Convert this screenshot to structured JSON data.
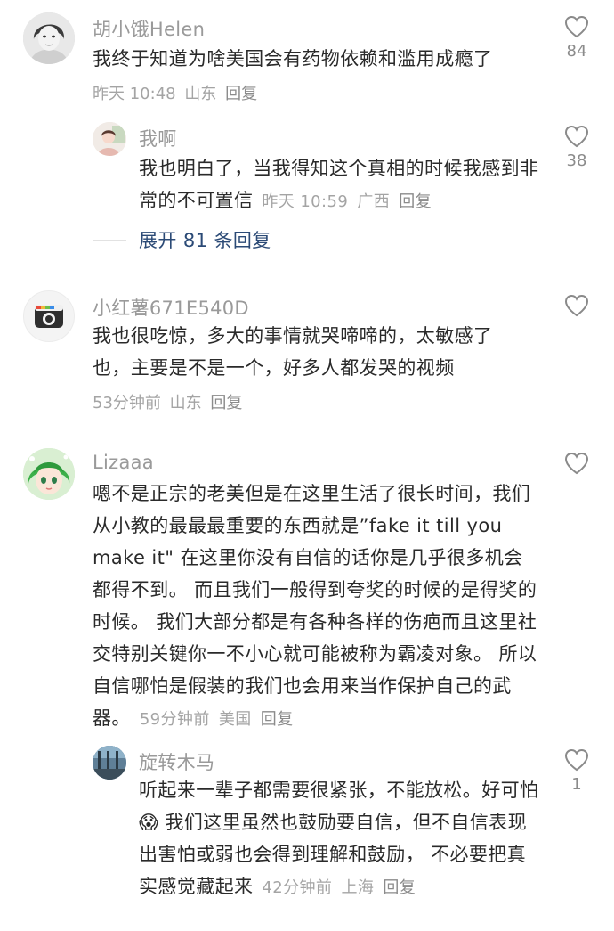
{
  "comments": [
    {
      "author": "胡小饿Helen",
      "text": "我终于知道为啥美国会有药物依赖和滥用成瘾了",
      "time": "昨天 10:48",
      "location": "山东",
      "reply_label": "回复",
      "likes": "84",
      "avatar_icon": "portrait-photo-avatar"
    },
    {
      "author": "我啊",
      "text": "我也明白了，当我得知这个真相的时候我感到非常的不可置信",
      "time": "昨天 10:59",
      "location": "广西",
      "reply_label": "回复",
      "likes": "38",
      "avatar_icon": "portrait-photo-avatar"
    },
    {
      "author": "小红薯671E540D",
      "text": "我也很吃惊，多大的事情就哭啼啼的，太敏感了也，主要是不是一个，好多人都发哭的视频",
      "time": "53分钟前",
      "location": "山东",
      "reply_label": "回复",
      "likes": "",
      "avatar_icon": "camera-avatar"
    },
    {
      "author": "Lizaaa",
      "text": "嗯不是正宗的老美但是在这里生活了很长时间，我们从小教的最最最重要的东西就是”fake it till you make it\" 在这里你没有自信的话你是几乎很多机会都得不到。 而且我们一般得到夸奖的时候的是得奖的时候。 我们大部分都是有各种各样的伤疤而且这里社交特别关键你一不小心就可能被称为霸凌对象。 所以自信哪怕是假装的我们也会用来当作保护自己的武器。",
      "time": "59分钟前",
      "location": "美国",
      "reply_label": "回复",
      "likes": "",
      "avatar_icon": "anime-avatar"
    },
    {
      "author": "旋转木马",
      "text": "听起来一辈子都需要很紧张，不能放松。好可怕😱 我们这里虽然也鼓励要自信，但不自信表现出害怕或弱也会得到理解和鼓励， 不必要把真实感觉藏起来",
      "time": "42分钟前",
      "location": "上海",
      "reply_label": "回复",
      "likes": "1",
      "avatar_icon": "window-photo-avatar"
    }
  ],
  "expand_replies": "展开 81 条回复",
  "colors": {
    "author": "#9a9a9a",
    "text": "#2a2a2a",
    "meta": "#a4a4a4",
    "link": "#2b4a76"
  }
}
